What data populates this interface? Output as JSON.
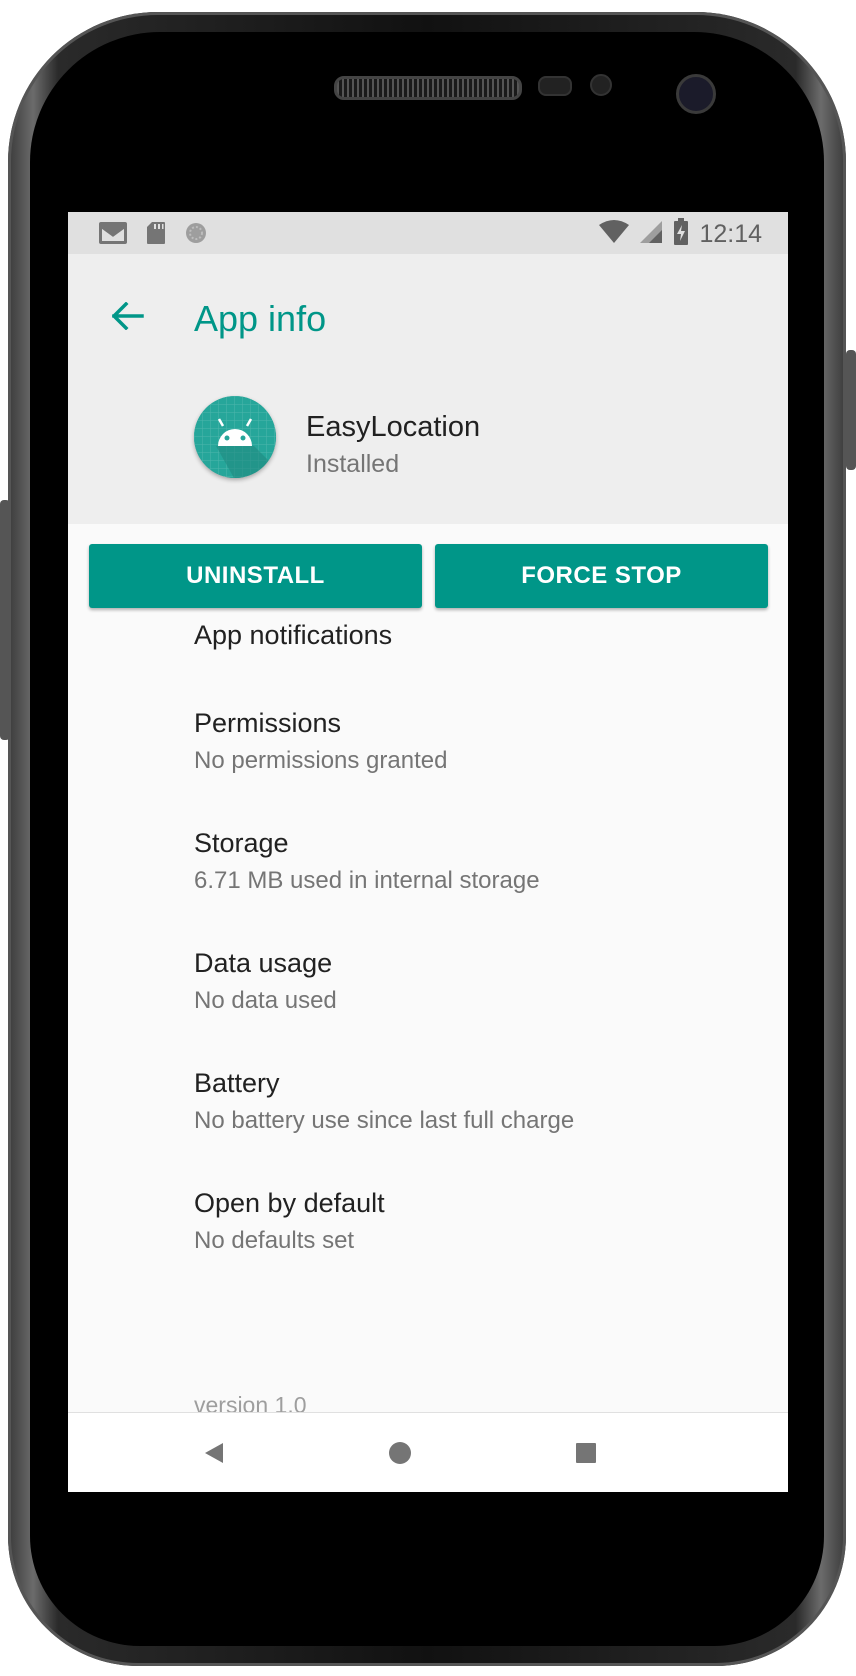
{
  "status_bar": {
    "time": "12:14",
    "left_icons": [
      "gmail-icon",
      "sd-card-icon",
      "sync-icon"
    ],
    "right_icons": [
      "wifi-icon",
      "cell-signal-icon",
      "battery-charging-icon"
    ]
  },
  "header": {
    "title": "App info",
    "app_name": "EasyLocation",
    "app_status": "Installed"
  },
  "actions": {
    "uninstall_label": "UNINSTALL",
    "force_stop_label": "FORCE STOP"
  },
  "settings": [
    {
      "title": "App notifications",
      "subtitle": ""
    },
    {
      "title": "Permissions",
      "subtitle": "No permissions granted"
    },
    {
      "title": "Storage",
      "subtitle": "6.71 MB used in internal storage"
    },
    {
      "title": "Data usage",
      "subtitle": "No data used"
    },
    {
      "title": "Battery",
      "subtitle": "No battery use since last full charge"
    },
    {
      "title": "Open by default",
      "subtitle": "No defaults set"
    }
  ],
  "version_text": "version 1.0",
  "colors": {
    "accent": "#009688",
    "header_bg": "#eeeeee",
    "status_bar_bg": "#e0e0e0"
  }
}
